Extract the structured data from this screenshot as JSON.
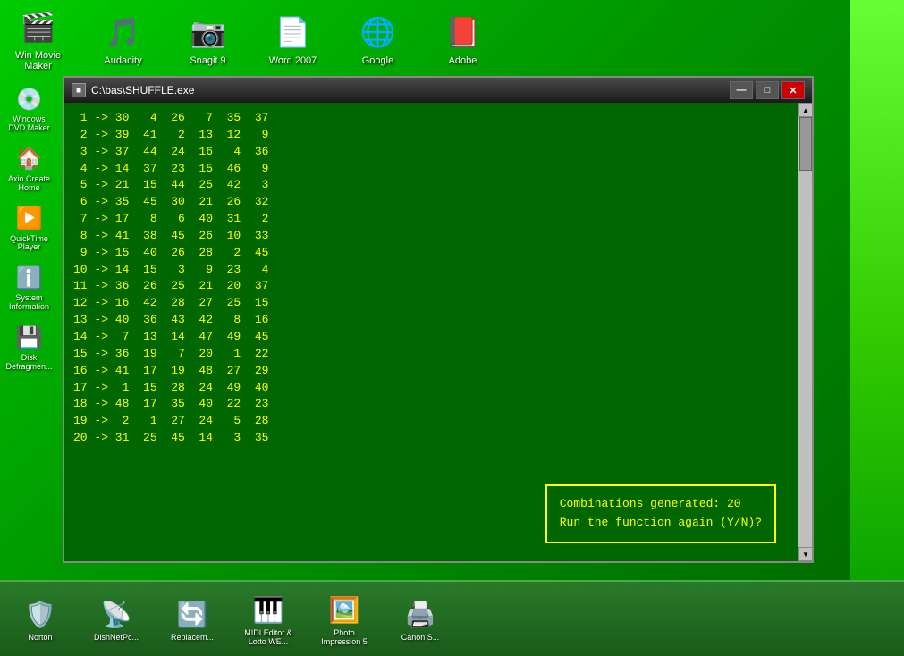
{
  "desktop": {
    "top_icons": [
      {
        "id": "win-movie-maker",
        "label": "Win Movie\nMaker",
        "emoji": "🎬"
      },
      {
        "id": "audacity",
        "label": "Audacity",
        "emoji": "🎵"
      },
      {
        "id": "snagit",
        "label": "Snagit 9",
        "emoji": "📷"
      },
      {
        "id": "word2007",
        "label": "Word 2007",
        "emoji": "📄"
      },
      {
        "id": "google",
        "label": "Google",
        "emoji": "🌐"
      },
      {
        "id": "adobe",
        "label": "Adobe",
        "emoji": "📕"
      }
    ],
    "sidebar_icons": [
      {
        "id": "windows-dvd-maker",
        "label": "Windows\nDVD Maker",
        "emoji": "💿"
      },
      {
        "id": "axio-create-home",
        "label": "Axio Create\nHome",
        "emoji": "🏠"
      },
      {
        "id": "quicktime-player",
        "label": "QuickTime\nPlayer",
        "emoji": "▶️"
      },
      {
        "id": "system-information",
        "label": "System\nInformation",
        "emoji": "ℹ️"
      },
      {
        "id": "disk-defragmenter",
        "label": "Disk\nDefragmen...",
        "emoji": "💾"
      }
    ],
    "taskbar_icons": [
      {
        "id": "norton",
        "label": "Norton",
        "emoji": "🛡️"
      },
      {
        "id": "dishnetpc",
        "label": "DishNetPc...",
        "emoji": "📡"
      },
      {
        "id": "replacem",
        "label": "Replacem...",
        "emoji": "🔄"
      },
      {
        "id": "midi-editor",
        "label": "MIDI Editor &\nLotto WE...",
        "emoji": "🎹"
      },
      {
        "id": "photo-impression",
        "label": "Photo\nImpression 5",
        "emoji": "🖼️"
      },
      {
        "id": "canon",
        "label": "Canon S...",
        "emoji": "🖨️"
      }
    ]
  },
  "console": {
    "title": "C:\\bas\\SHUFFLE.exe",
    "titlebar_icon": "■",
    "minimize_label": "—",
    "maximize_label": "□",
    "close_label": "✕",
    "lines": [
      " 1 -> 30   4  26   7  35  37",
      " 2 -> 39  41   2  13  12   9",
      " 3 -> 37  44  24  16   4  36",
      " 4 -> 14  37  23  15  46   9",
      " 5 -> 21  15  44  25  42   3",
      " 6 -> 35  45  30  21  26  32",
      " 7 -> 17   8   6  40  31   2",
      " 8 -> 41  38  45  26  10  33",
      " 9 -> 15  40  26  28   2  45",
      "10 -> 14  15   3   9  23   4",
      "11 -> 36  26  25  21  20  37",
      "12 -> 16  42  28  27  25  15",
      "13 -> 40  36  43  42   8  16",
      "14 ->  7  13  14  47  49  45",
      "15 -> 36  19   7  20   1  22",
      "16 -> 41  17  19  48  27  29",
      "17 ->  1  15  28  24  49  40",
      "18 -> 48  17  35  40  22  23",
      "19 ->  2   1  27  24   5  28",
      "20 -> 31  25  45  14   3  35"
    ],
    "prompt": {
      "line1": "Combinations generated:  20",
      "line2": "Run the function again (Y/N)?"
    }
  }
}
